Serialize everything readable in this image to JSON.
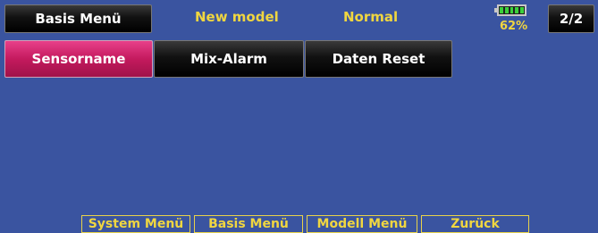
{
  "header": {
    "menu_label": "Basis Menü",
    "model_name": "New model",
    "condition": "Normal",
    "battery_percent": "62%",
    "page_indicator": "2/2"
  },
  "tabs": [
    {
      "label": "Sensorname",
      "selected": true
    },
    {
      "label": "Mix-Alarm",
      "selected": false
    },
    {
      "label": "Daten Reset",
      "selected": false
    }
  ],
  "bottom_nav": [
    {
      "label": "System Menü"
    },
    {
      "label": "Basis Menü"
    },
    {
      "label": "Modell Menü"
    },
    {
      "label": "Zurück"
    }
  ],
  "colors": {
    "background": "#3a54a0",
    "accent_yellow": "#f0d640",
    "selected_tab": "#c41a5e",
    "battery_green": "#3bd13b"
  },
  "icons": {
    "battery": "battery-icon"
  }
}
